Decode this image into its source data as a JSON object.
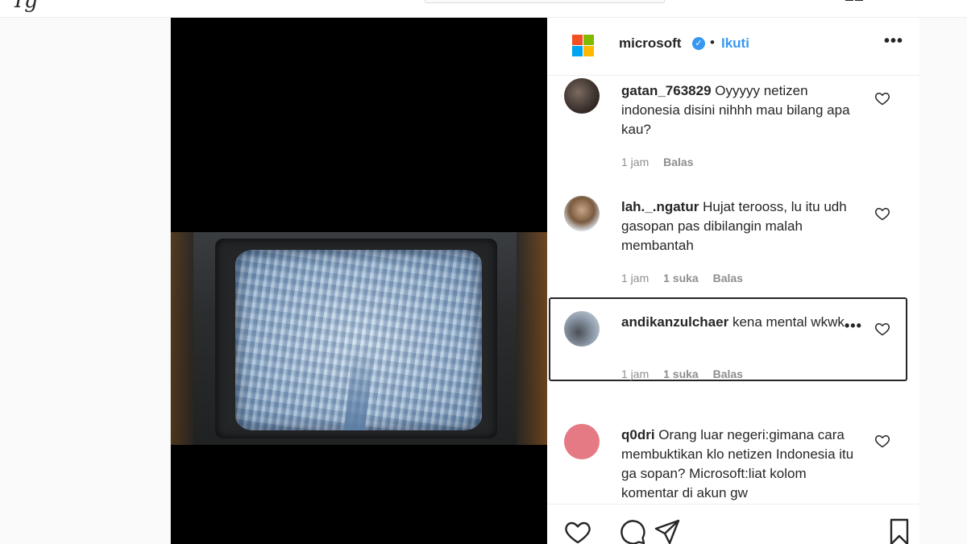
{
  "header": {
    "username": "microsoft",
    "separator": "•",
    "follow_label": "Ikuti",
    "more_label": "•••"
  },
  "comments": [
    {
      "username": "gatan_763829",
      "text": "Oyyyyy netizen indonesia disini nihhh mau bilang apa kau?",
      "time": "1 jam",
      "likes": "",
      "reply_label": "Balas"
    },
    {
      "username": "lah._.ngatur",
      "text": "Hujat terooss, lu itu udh gasopan pas dibilangin malah membantah",
      "time": "1 jam",
      "likes": "1 suka",
      "reply_label": "Balas"
    },
    {
      "username": "andikanzulchaer",
      "text": "kena mental wkwk",
      "time": "1 jam",
      "likes": "1 suka",
      "reply_label": "Balas",
      "more_label": "•••"
    },
    {
      "username": "q0dri",
      "text": "Orang luar negeri:gimana cara membuktikan klo netizen Indonesia itu ga sopan? Microsoft:liat kolom komentar di akun gw",
      "time": "",
      "likes": "",
      "reply_label": ""
    }
  ],
  "icons": {
    "brand": "microsoft-logo",
    "verified": "verified-badge-icon",
    "comment_like": "heart-icon",
    "actions": [
      "heart-icon",
      "comment-icon",
      "share-icon",
      "bookmark-icon"
    ]
  },
  "colors": {
    "link_blue": "#3897f0",
    "text": "#262626",
    "muted": "#8e8e8e",
    "media_bg": "#000000"
  }
}
